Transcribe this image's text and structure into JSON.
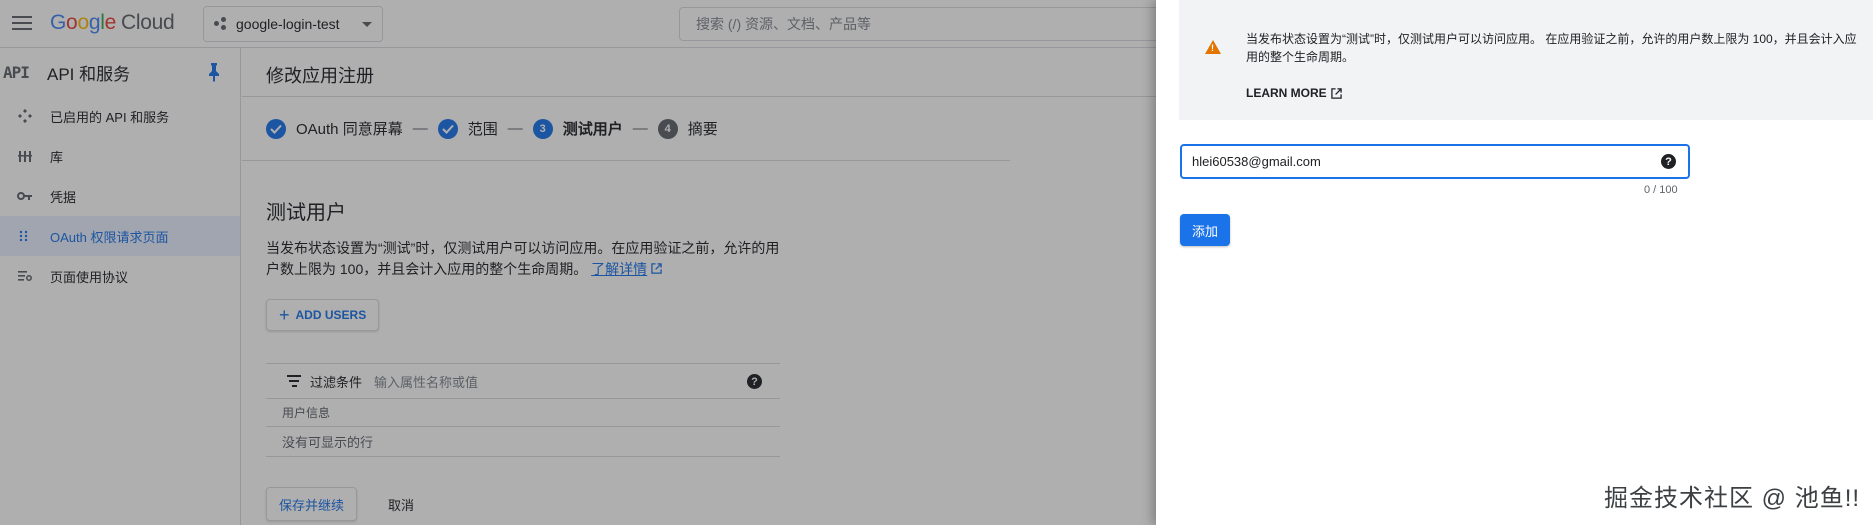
{
  "topbar": {
    "logo_google": [
      "G",
      "o",
      "o",
      "g",
      "l",
      "e"
    ],
    "logo_cloud": "Cloud",
    "project_name": "google-login-test",
    "search_placeholder": "搜索 (/) 资源、文档、产品等"
  },
  "sidebar": {
    "api_icon_text": "API",
    "title": "API 和服务",
    "items": [
      {
        "label": "已启用的 API 和服务",
        "icon": "diamond-move-icon"
      },
      {
        "label": "库",
        "icon": "library-icon"
      },
      {
        "label": "凭据",
        "icon": "key-icon"
      },
      {
        "label": "OAuth 权限请求页面",
        "icon": "dots-grid-icon",
        "active": true
      },
      {
        "label": "页面使用协议",
        "icon": "settings-list-icon"
      }
    ]
  },
  "main": {
    "title": "修改应用注册",
    "steps": [
      {
        "label": "OAuth 同意屏幕",
        "state": "done"
      },
      {
        "label": "范围",
        "state": "done"
      },
      {
        "label": "测试用户",
        "state": "current",
        "number": "3"
      },
      {
        "label": "摘要",
        "state": "todo",
        "number": "4"
      }
    ],
    "step_separator": "—",
    "section_title": "测试用户",
    "description": "当发布状态设置为“测试”时，仅测试用户可以访问应用。在应用验证之前，允许的用户数上限为 100，并且会计入应用的整个生命周期。",
    "learn_more_link": "了解详情",
    "add_users_label": "ADD USERS",
    "filter_label": "过滤条件",
    "filter_placeholder": "输入属性名称或值",
    "table_header": "用户信息",
    "table_empty": "没有可显示的行",
    "save_button": "保存并继续",
    "cancel_button": "取消"
  },
  "panel": {
    "notice_text": "当发布状态设置为“测试”时，仅测试用户可以访问应用。 在应用验证之前，允许的用户数上限为 100，并且会计入应用的整个生命周期。",
    "learn_more": "LEARN MORE",
    "email_value": "hlei60538@gmail.com",
    "counter": "0 / 100",
    "add_button": "添加"
  },
  "watermark": "掘金技术社区 @ 池鱼!!",
  "colors": {
    "accent": "#1a73e8",
    "warning": "#e37400",
    "scrim": "rgba(32,33,36,0.36)"
  }
}
